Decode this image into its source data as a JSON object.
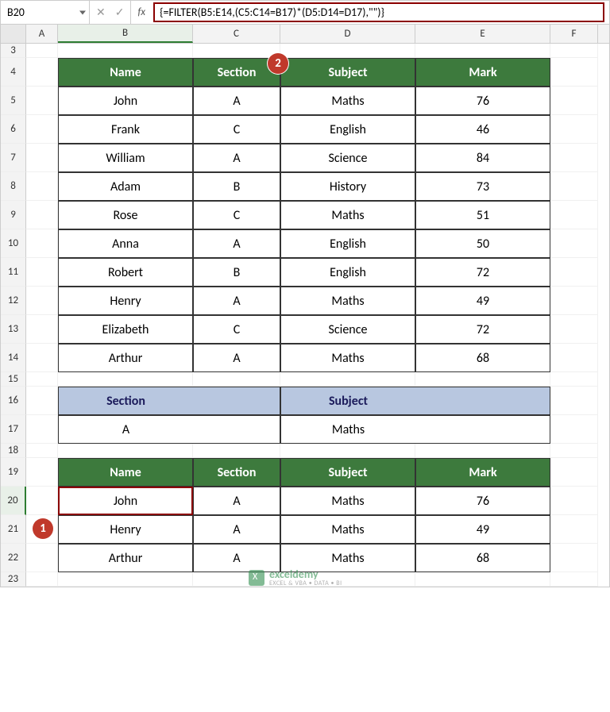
{
  "name_box": "B20",
  "formula": "{=FILTER(B5:E14,(C5:C14=B17)*(D5:D14=D17),\"\")}",
  "col_headers": [
    "A",
    "B",
    "C",
    "D",
    "E",
    "F"
  ],
  "row_spec": [
    {
      "n": "3",
      "short": true
    },
    {
      "n": "4"
    },
    {
      "n": "5"
    },
    {
      "n": "6"
    },
    {
      "n": "7"
    },
    {
      "n": "8"
    },
    {
      "n": "9"
    },
    {
      "n": "10"
    },
    {
      "n": "11"
    },
    {
      "n": "12"
    },
    {
      "n": "13"
    },
    {
      "n": "14"
    },
    {
      "n": "15",
      "short": true
    },
    {
      "n": "16"
    },
    {
      "n": "17"
    },
    {
      "n": "18",
      "short": true
    },
    {
      "n": "19"
    },
    {
      "n": "20",
      "active": true
    },
    {
      "n": "21"
    },
    {
      "n": "22"
    },
    {
      "n": "23",
      "short": true
    }
  ],
  "table1": {
    "headers": [
      "Name",
      "Section",
      "Subject",
      "Mark"
    ],
    "rows": [
      [
        "John",
        "A",
        "Maths",
        "76"
      ],
      [
        "Frank",
        "C",
        "English",
        "46"
      ],
      [
        "William",
        "A",
        "Science",
        "84"
      ],
      [
        "Adam",
        "B",
        "History",
        "73"
      ],
      [
        "Rose",
        "C",
        "Maths",
        "51"
      ],
      [
        "Anna",
        "A",
        "English",
        "50"
      ],
      [
        "Robert",
        "B",
        "English",
        "72"
      ],
      [
        "Henry",
        "A",
        "Maths",
        "49"
      ],
      [
        "Elizabeth",
        "C",
        "Science",
        "72"
      ],
      [
        "Arthur",
        "A",
        "Maths",
        "68"
      ]
    ]
  },
  "criteria": {
    "headers": [
      "Section",
      "Subject"
    ],
    "values": [
      "A",
      "Maths"
    ]
  },
  "table2": {
    "headers": [
      "Name",
      "Section",
      "Subject",
      "Mark"
    ],
    "rows": [
      [
        "John",
        "A",
        "Maths",
        "76"
      ],
      [
        "Henry",
        "A",
        "Maths",
        "49"
      ],
      [
        "Arthur",
        "A",
        "Maths",
        "68"
      ]
    ]
  },
  "badge1": "1",
  "badge2": "2",
  "watermark": {
    "title": "exceldemy",
    "sub": "EXCEL & VBA • DATA • BI"
  }
}
